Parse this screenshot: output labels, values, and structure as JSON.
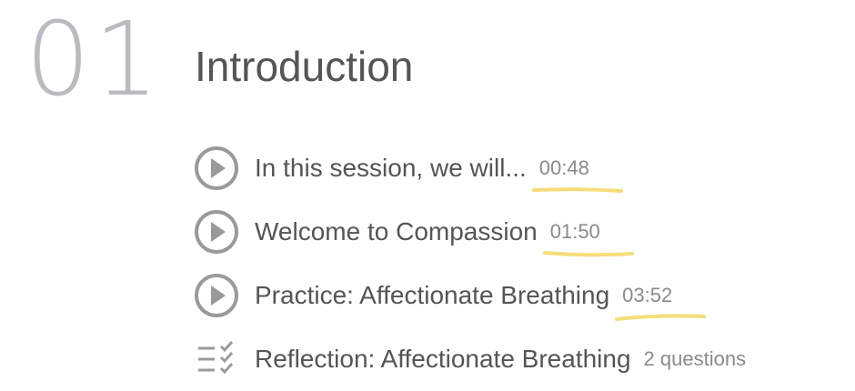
{
  "section": {
    "number": "01",
    "title": "Introduction"
  },
  "lessons": [
    {
      "icon": "play-circle-icon",
      "title": "In this session, we will...",
      "meta": "00:48",
      "highlighted": true
    },
    {
      "icon": "play-circle-icon",
      "title": "Welcome to Compassion",
      "meta": "01:50",
      "highlighted": true
    },
    {
      "icon": "play-circle-icon",
      "title": "Practice: Affectionate Breathing",
      "meta": "03:52",
      "highlighted": true
    },
    {
      "icon": "checklist-icon",
      "title": "Reflection: Affectionate Breathing",
      "meta": "2 questions",
      "highlighted": false
    }
  ],
  "colors": {
    "number": "#b8bcc1",
    "text": "#555555",
    "meta": "#8a8a8a",
    "icon": "#9a9a9a",
    "highlight": "#f6dc7a"
  }
}
